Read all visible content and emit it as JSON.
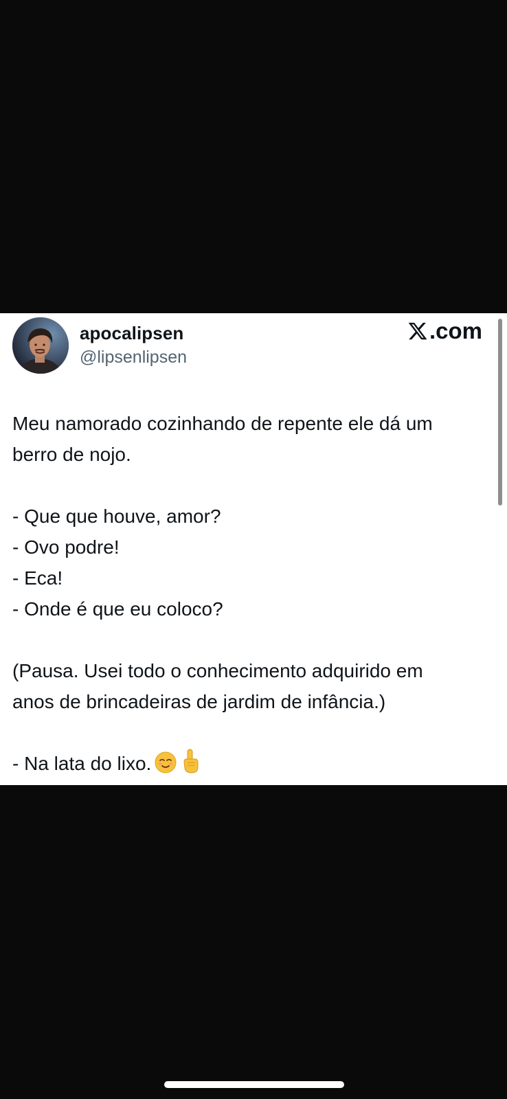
{
  "tweet": {
    "author": {
      "display_name": "apocalipsen",
      "handle": "@lipsenlipsen",
      "avatar_icon": "avatar-photo"
    },
    "source": {
      "logo_icon": "x-logo-icon",
      "domain_suffix": ".com"
    },
    "body": {
      "line1": "Meu namorado cozinhando de repente ele dá um",
      "line2": "berro de nojo.",
      "dialogue": [
        "- Que que houve, amor?",
        "- Ovo podre!",
        "- Eca!",
        "- Onde é que eu coloco?"
      ],
      "pause_line1": "(Pausa. Usei todo o conhecimento adquirido em",
      "pause_line2": "anos de brincadeiras de jardim de infância.)",
      "final_line": "- Na lata do lixo.",
      "final_emojis": [
        "relieved-face-icon",
        "index-pointing-up-icon"
      ]
    }
  },
  "colors": {
    "background": "#0a0a0a",
    "card": "#ffffff",
    "text_primary": "#0f1419",
    "text_secondary": "#536471"
  }
}
